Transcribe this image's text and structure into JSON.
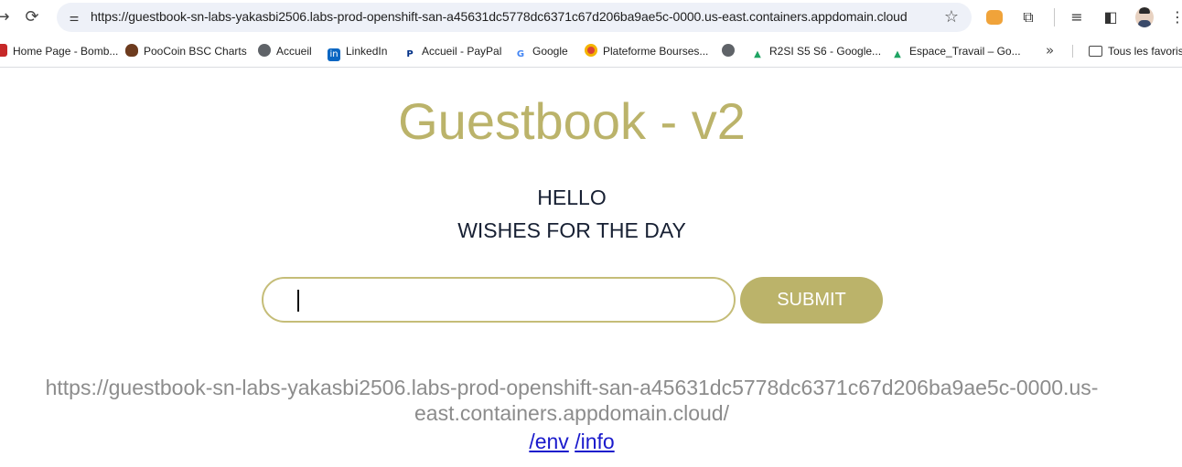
{
  "browser": {
    "url": "https://guestbook-sn-labs-yakasbi2506.labs-prod-openshift-san-a45631dc5778dc6371c67d206ba9ae5c-0000.us-east.containers.appdomain.cloud",
    "icons": {
      "back": "arrow-right-icon",
      "reload": "reload-icon",
      "site_info": "tune-icon",
      "bookmark": "star-icon",
      "metamask": "fox-icon",
      "extensions": "puzzle-icon",
      "media": "playlist-icon",
      "sidepanel": "side-panel-icon",
      "menu": "kebab-menu-icon"
    }
  },
  "bookmarks": {
    "items": [
      {
        "label": "Home Page - Bomb...",
        "icon": "red-square-icon",
        "color": "#c62828"
      },
      {
        "label": "PooCoin BSC Charts",
        "icon": "poocoin-icon",
        "color": "#6d3b1e"
      },
      {
        "label": "Accueil",
        "icon": "globe-icon",
        "color": "#5f6368"
      },
      {
        "label": "LinkedIn",
        "icon": "linkedin-icon",
        "color": "#0a66c2"
      },
      {
        "label": "Accueil - PayPal",
        "icon": "paypal-icon",
        "color": "#003087"
      },
      {
        "label": "Google",
        "icon": "google-icon",
        "color": "#4285f4"
      },
      {
        "label": "Plateforme Bourses...",
        "icon": "chrome-icon",
        "color": "#db4437"
      },
      {
        "label": "",
        "icon": "globe-icon",
        "color": "#5f6368"
      },
      {
        "label": "R2SI S5 S6 - Google...",
        "icon": "drive-icon",
        "color": "#1fa463"
      },
      {
        "label": "Espace_Travail – Go...",
        "icon": "drive-icon",
        "color": "#1fa463"
      }
    ],
    "more": "»",
    "all_bookmarks": "Tous les favoris"
  },
  "app": {
    "title": "Guestbook - v2",
    "entries": [
      "HELLO",
      "WISHES FOR THE DAY"
    ],
    "input_value": "",
    "submit_label": "SUBMIT",
    "host_url_line1": "https://guestbook-sn-labs-yakasbi2506.labs-prod-openshift-san-a45631dc5778dc6371c67d206ba9ae5c-0000.us-",
    "host_url_line2": "east.containers.appdomain.cloud/",
    "link_env": "/env",
    "link_info": "/info",
    "colors": {
      "accent": "#bbb36a",
      "text": "#172033",
      "muted": "#8c8c8c",
      "link": "#1a1acc"
    }
  }
}
